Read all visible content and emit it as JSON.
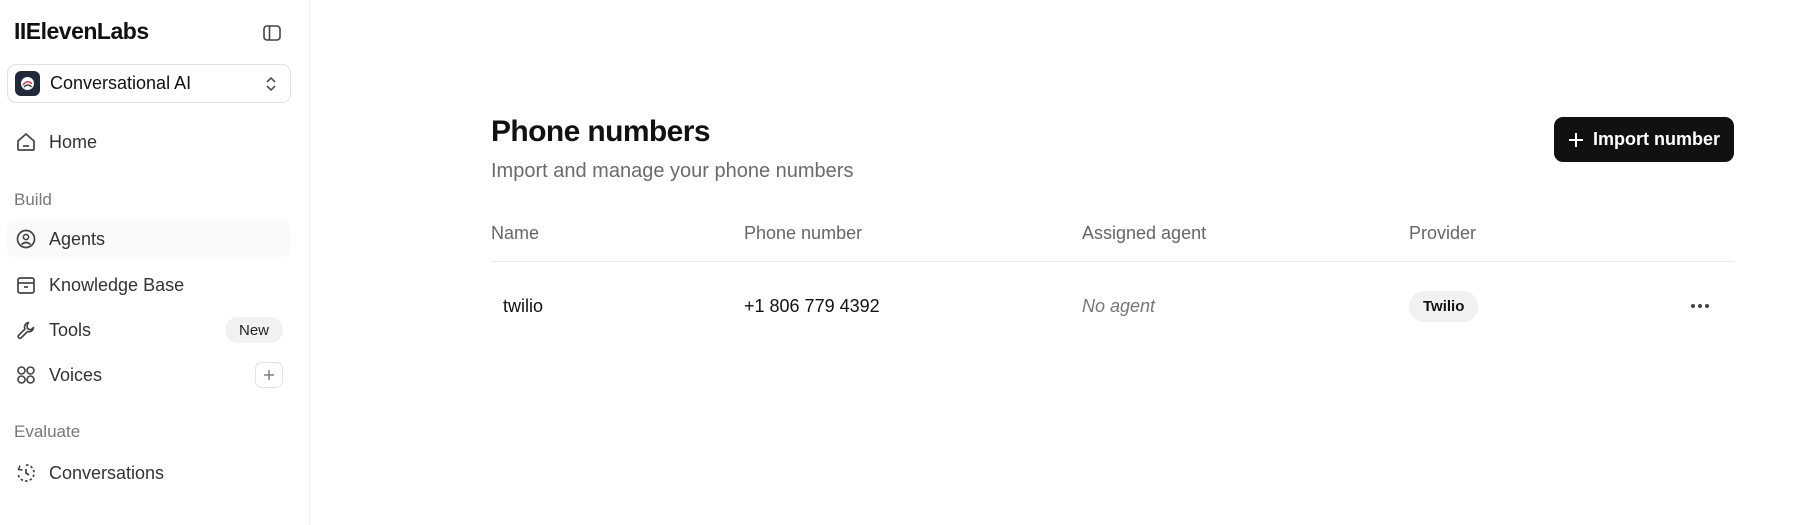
{
  "sidebar": {
    "logo": "IIElevenLabs",
    "workspace": {
      "label": "Conversational AI"
    },
    "home": {
      "label": "Home"
    },
    "sections": {
      "build": "Build",
      "evaluate": "Evaluate"
    },
    "items": {
      "agents": "Agents",
      "knowledge_base": "Knowledge Base",
      "tools": "Tools",
      "tools_badge": "New",
      "voices": "Voices",
      "conversations": "Conversations"
    }
  },
  "main": {
    "title": "Phone numbers",
    "subtitle": "Import and manage your phone numbers",
    "import_button": "Import number",
    "table": {
      "columns": [
        "Name",
        "Phone number",
        "Assigned agent",
        "Provider"
      ],
      "rows": [
        {
          "name": "twilio",
          "phone": "+1 806 779 4392",
          "agent": "No agent",
          "provider": "Twilio"
        }
      ]
    }
  }
}
